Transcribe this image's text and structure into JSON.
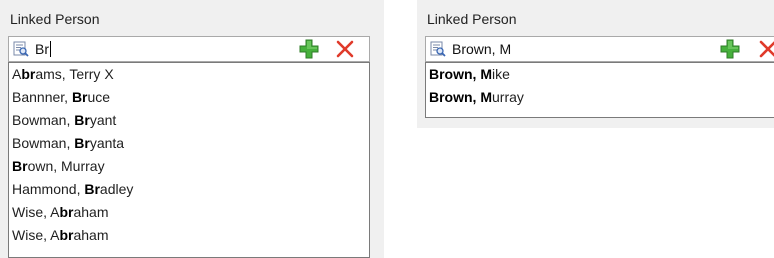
{
  "left": {
    "label": "Linked Person",
    "input_value": "Br",
    "suggestions": [
      [
        {
          "t": "A",
          "b": false
        },
        {
          "t": "br",
          "b": true
        },
        {
          "t": "ams, Terry X",
          "b": false
        }
      ],
      [
        {
          "t": "Bannner, ",
          "b": false
        },
        {
          "t": "Br",
          "b": true
        },
        {
          "t": "uce",
          "b": false
        }
      ],
      [
        {
          "t": "Bowman, ",
          "b": false
        },
        {
          "t": "Br",
          "b": true
        },
        {
          "t": "yant",
          "b": false
        }
      ],
      [
        {
          "t": "Bowman, ",
          "b": false
        },
        {
          "t": "Br",
          "b": true
        },
        {
          "t": "yanta",
          "b": false
        }
      ],
      [
        {
          "t": "Br",
          "b": true
        },
        {
          "t": "own, Murray",
          "b": false
        }
      ],
      [
        {
          "t": "Hammond, ",
          "b": false
        },
        {
          "t": "Br",
          "b": true
        },
        {
          "t": "adley",
          "b": false
        }
      ],
      [
        {
          "t": "Wise, A",
          "b": false
        },
        {
          "t": "br",
          "b": true
        },
        {
          "t": "aham",
          "b": false
        }
      ],
      [
        {
          "t": "Wise, A",
          "b": false
        },
        {
          "t": "br",
          "b": true
        },
        {
          "t": "aham",
          "b": false
        }
      ]
    ]
  },
  "right": {
    "label": "Linked Person",
    "input_value": "Brown, M",
    "suggestions": [
      [
        {
          "t": "Brown, M",
          "b": true
        },
        {
          "t": "ike",
          "b": false
        }
      ],
      [
        {
          "t": "Brown, M",
          "b": true
        },
        {
          "t": "urray",
          "b": false
        }
      ]
    ]
  },
  "icons": {
    "lookup": "lookup-icon",
    "add": "add-icon",
    "delete": "delete-icon"
  },
  "colors": {
    "panel_bg": "#f0f0f0",
    "add_green": "#46b03c",
    "delete_red": "#e03a2a",
    "lookup_blue": "#3a67b3"
  }
}
